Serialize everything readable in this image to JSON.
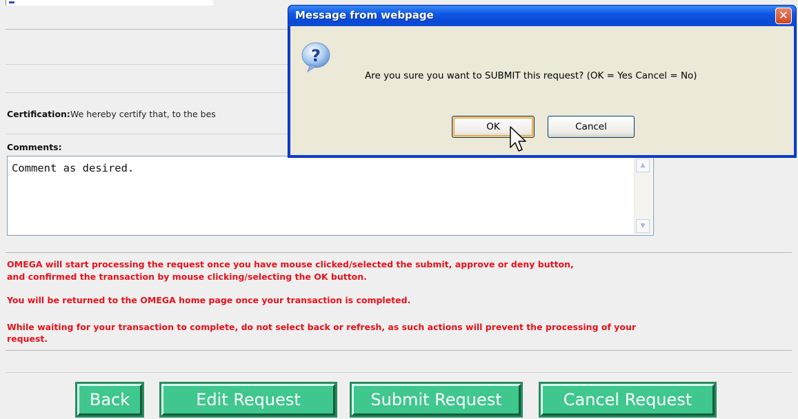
{
  "certification": {
    "label": "Certification:",
    "text": "We hereby certify that, to the bes"
  },
  "comments": {
    "label": "Comments:",
    "value": "Comment as desired."
  },
  "notices": [
    "OMEGA will start processing the request once you have mouse clicked/selected the submit, approve or deny button,",
    "and confirmed the transaction by mouse clicking/selecting the OK button.",
    "You will be returned to the OMEGA home page once your transaction is completed.",
    "While waiting for your transaction to complete, do not select back or refresh, as such actions will prevent the processing of your",
    "request."
  ],
  "buttons": {
    "back": "Back",
    "edit": "Edit Request",
    "submit": "Submit Request",
    "cancel": "Cancel Request"
  },
  "dialog": {
    "title": "Message from webpage",
    "message": "Are you sure you want to SUBMIT this request? (OK = Yes   Cancel = No)",
    "ok_label": "OK",
    "cancel_label": "Cancel",
    "icon": "question-icon"
  },
  "colors": {
    "notice_text": "#e8121b",
    "button_green": "#3fc78e",
    "dialog_title_blue": "#0f57e5"
  }
}
